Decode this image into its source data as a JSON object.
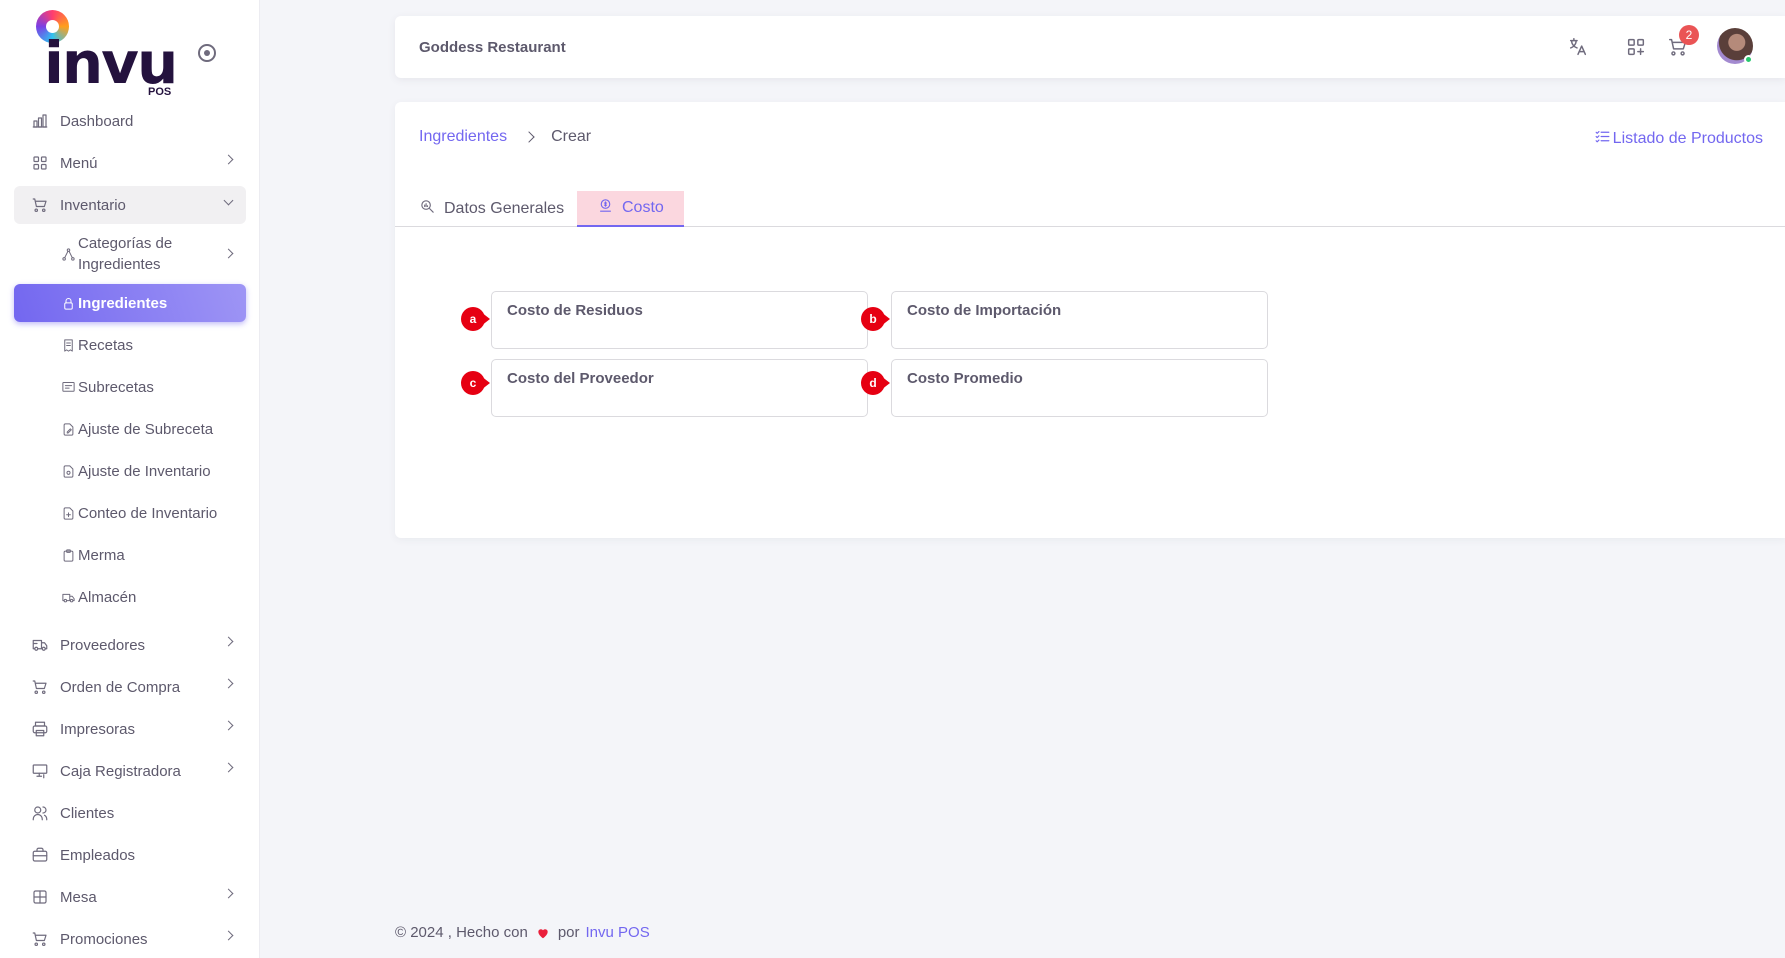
{
  "brand": {
    "name": "invu",
    "sub": "POS"
  },
  "sidebar": {
    "items": [
      {
        "label": "Dashboard",
        "icon": "chart-bar-icon",
        "chevron": false
      },
      {
        "label": "Menú",
        "icon": "grid-icon",
        "chevron": true
      },
      {
        "label": "Inventario",
        "icon": "shopping-cart-icon",
        "chevron": true,
        "open": true
      }
    ],
    "inventory_sub": [
      {
        "label": "Categorías de Ingredientes",
        "icon": "hierarchy-icon"
      },
      {
        "label": "Ingredientes",
        "icon": "lock-icon",
        "active": true
      },
      {
        "label": "Recetas",
        "icon": "receipt-icon"
      },
      {
        "label": "Subrecetas",
        "icon": "list-details-icon"
      },
      {
        "label": "Ajuste de Subreceta",
        "icon": "file-edit-icon"
      },
      {
        "label": "Ajuste de Inventario",
        "icon": "file-settings-icon"
      },
      {
        "label": "Conteo de Inventario",
        "icon": "file-plus-icon"
      },
      {
        "label": "Merma",
        "icon": "clipboard-icon"
      },
      {
        "label": "Almacén",
        "icon": "truck-icon"
      }
    ],
    "more_items": [
      {
        "label": "Proveedores",
        "icon": "truck-delivery-icon",
        "chevron": true
      },
      {
        "label": "Orden de Compra",
        "icon": "shopping-cart-icon",
        "chevron": true
      },
      {
        "label": "Impresoras",
        "icon": "printer-icon",
        "chevron": true
      },
      {
        "label": "Caja Registradora",
        "icon": "cash-register-icon",
        "chevron": true
      },
      {
        "label": "Clientes",
        "icon": "users-icon",
        "chevron": false
      },
      {
        "label": "Empleados",
        "icon": "briefcase-icon",
        "chevron": false
      },
      {
        "label": "Mesa",
        "icon": "table-icon",
        "chevron": true
      },
      {
        "label": "Promociones",
        "icon": "shopping-cart-icon",
        "chevron": true
      }
    ]
  },
  "topbar": {
    "title": "Goddess Restaurant",
    "cart_count": "2"
  },
  "breadcrumb": {
    "parent": "Ingredientes",
    "current": "Crear"
  },
  "list_link": "Listado de Productos",
  "tabs": [
    {
      "label": "Datos Generales",
      "icon": "search-report-icon",
      "active": false
    },
    {
      "label": "Costo",
      "icon": "coin-icon",
      "active": true
    }
  ],
  "fields": [
    {
      "marker": "a",
      "label": "Costo de Residuos",
      "value": ""
    },
    {
      "marker": "b",
      "label": "Costo de Importación",
      "value": ""
    },
    {
      "marker": "c",
      "label": "Costo del Proveedor",
      "value": ""
    },
    {
      "marker": "d",
      "label": "Costo Promedio",
      "value": ""
    }
  ],
  "footer": {
    "prefix": "© 2024 , Hecho con",
    "by": "por",
    "link": "Invu POS"
  },
  "colors": {
    "primary": "#7367f0",
    "marker": "#e60012",
    "active_tab_bg": "#fbd7df",
    "badge": "#ea5455"
  }
}
